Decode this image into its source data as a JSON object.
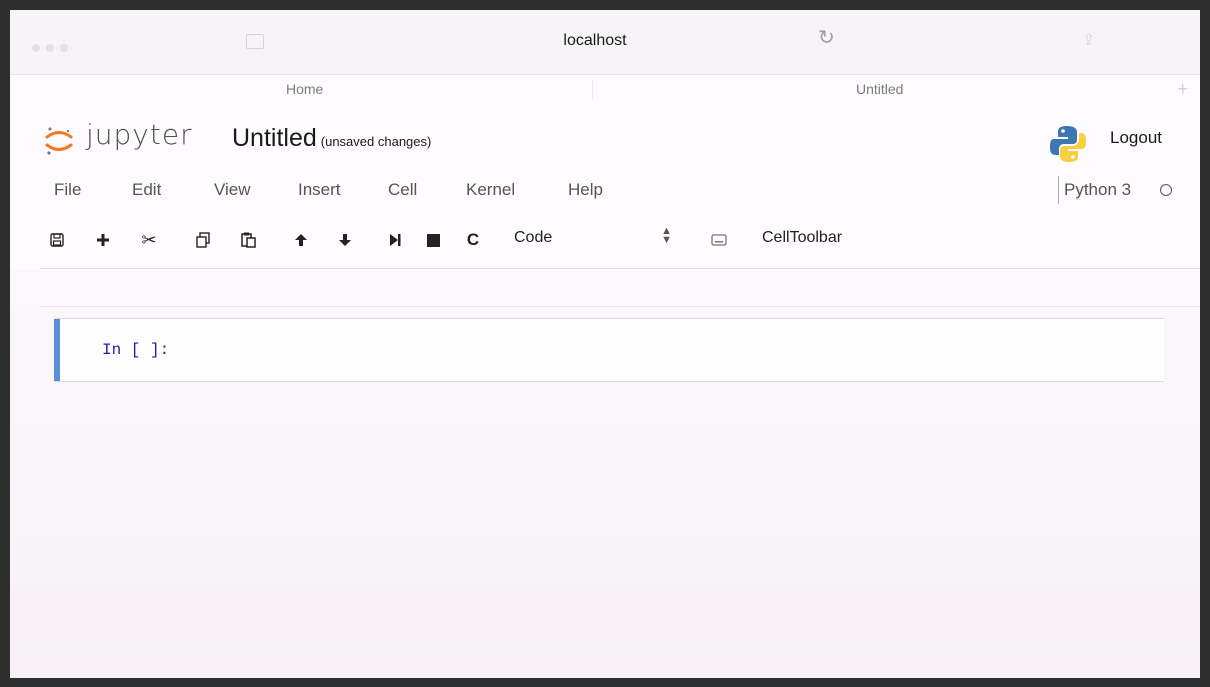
{
  "browser": {
    "url": "localhost",
    "tabs": [
      {
        "label": "Home"
      },
      {
        "label": "Untitled"
      }
    ],
    "new_tab": "+"
  },
  "header": {
    "logo_text": "jupyter",
    "notebook_title": "Untitled",
    "save_status": "(unsaved changes)",
    "logout_label": "Logout"
  },
  "menu": {
    "items": [
      "File",
      "Edit",
      "View",
      "Insert",
      "Cell",
      "Kernel",
      "Help"
    ],
    "kernel_name": "Python 3"
  },
  "toolbar": {
    "icons": [
      "save-icon",
      "plus-icon",
      "cut-icon",
      "copy-icon",
      "paste-icon",
      "arrow-up-icon",
      "arrow-down-icon",
      "run-icon",
      "stop-icon",
      "restart-icon"
    ],
    "cell_type": "Code",
    "cell_type_options": [
      "Code"
    ],
    "celltoolbar_label": "CellToolbar"
  },
  "cells": [
    {
      "prompt": "In [ ]:",
      "source": ""
    }
  ],
  "colors": {
    "cell_selected_bar": "#5c8edb",
    "prompt": "#1f1fa0",
    "jupyter_orange": "#f37726"
  }
}
